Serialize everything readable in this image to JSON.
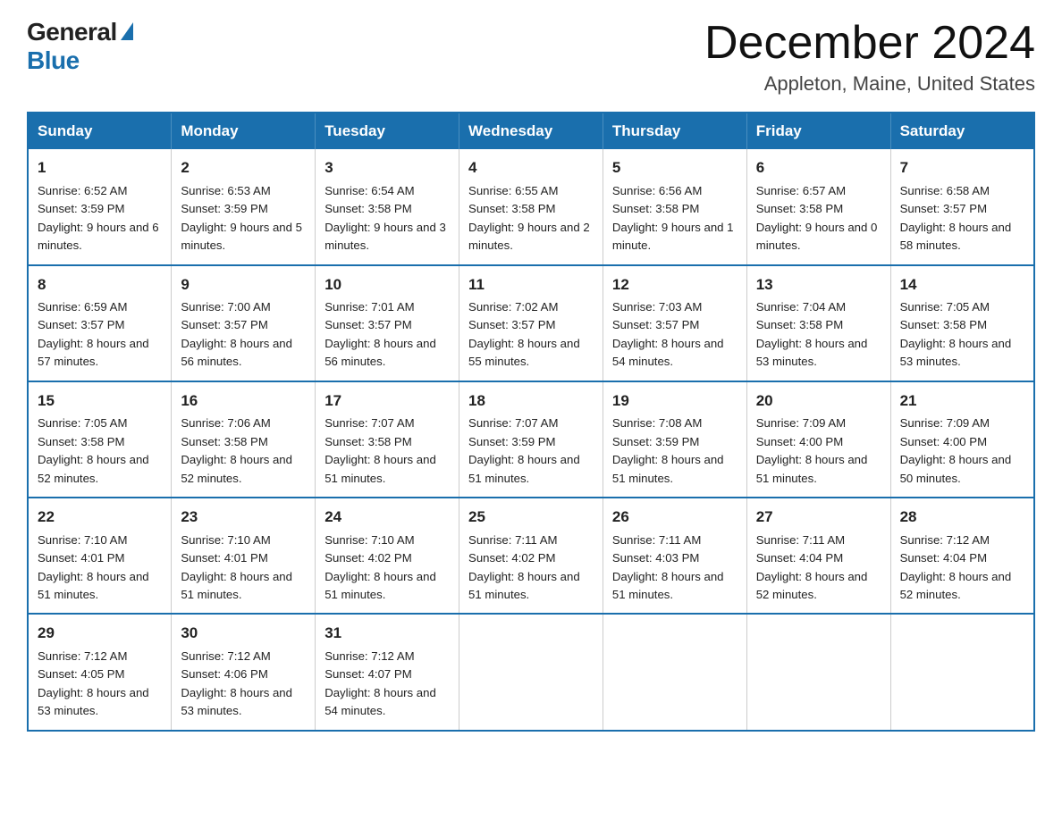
{
  "header": {
    "logo_general": "General",
    "logo_blue": "Blue",
    "month_title": "December 2024",
    "location": "Appleton, Maine, United States"
  },
  "days_of_week": [
    "Sunday",
    "Monday",
    "Tuesday",
    "Wednesday",
    "Thursday",
    "Friday",
    "Saturday"
  ],
  "weeks": [
    [
      {
        "day": "1",
        "sunrise": "6:52 AM",
        "sunset": "3:59 PM",
        "daylight": "9 hours and 6 minutes."
      },
      {
        "day": "2",
        "sunrise": "6:53 AM",
        "sunset": "3:59 PM",
        "daylight": "9 hours and 5 minutes."
      },
      {
        "day": "3",
        "sunrise": "6:54 AM",
        "sunset": "3:58 PM",
        "daylight": "9 hours and 3 minutes."
      },
      {
        "day": "4",
        "sunrise": "6:55 AM",
        "sunset": "3:58 PM",
        "daylight": "9 hours and 2 minutes."
      },
      {
        "day": "5",
        "sunrise": "6:56 AM",
        "sunset": "3:58 PM",
        "daylight": "9 hours and 1 minute."
      },
      {
        "day": "6",
        "sunrise": "6:57 AM",
        "sunset": "3:58 PM",
        "daylight": "9 hours and 0 minutes."
      },
      {
        "day": "7",
        "sunrise": "6:58 AM",
        "sunset": "3:57 PM",
        "daylight": "8 hours and 58 minutes."
      }
    ],
    [
      {
        "day": "8",
        "sunrise": "6:59 AM",
        "sunset": "3:57 PM",
        "daylight": "8 hours and 57 minutes."
      },
      {
        "day": "9",
        "sunrise": "7:00 AM",
        "sunset": "3:57 PM",
        "daylight": "8 hours and 56 minutes."
      },
      {
        "day": "10",
        "sunrise": "7:01 AM",
        "sunset": "3:57 PM",
        "daylight": "8 hours and 56 minutes."
      },
      {
        "day": "11",
        "sunrise": "7:02 AM",
        "sunset": "3:57 PM",
        "daylight": "8 hours and 55 minutes."
      },
      {
        "day": "12",
        "sunrise": "7:03 AM",
        "sunset": "3:57 PM",
        "daylight": "8 hours and 54 minutes."
      },
      {
        "day": "13",
        "sunrise": "7:04 AM",
        "sunset": "3:58 PM",
        "daylight": "8 hours and 53 minutes."
      },
      {
        "day": "14",
        "sunrise": "7:05 AM",
        "sunset": "3:58 PM",
        "daylight": "8 hours and 53 minutes."
      }
    ],
    [
      {
        "day": "15",
        "sunrise": "7:05 AM",
        "sunset": "3:58 PM",
        "daylight": "8 hours and 52 minutes."
      },
      {
        "day": "16",
        "sunrise": "7:06 AM",
        "sunset": "3:58 PM",
        "daylight": "8 hours and 52 minutes."
      },
      {
        "day": "17",
        "sunrise": "7:07 AM",
        "sunset": "3:58 PM",
        "daylight": "8 hours and 51 minutes."
      },
      {
        "day": "18",
        "sunrise": "7:07 AM",
        "sunset": "3:59 PM",
        "daylight": "8 hours and 51 minutes."
      },
      {
        "day": "19",
        "sunrise": "7:08 AM",
        "sunset": "3:59 PM",
        "daylight": "8 hours and 51 minutes."
      },
      {
        "day": "20",
        "sunrise": "7:09 AM",
        "sunset": "4:00 PM",
        "daylight": "8 hours and 51 minutes."
      },
      {
        "day": "21",
        "sunrise": "7:09 AM",
        "sunset": "4:00 PM",
        "daylight": "8 hours and 50 minutes."
      }
    ],
    [
      {
        "day": "22",
        "sunrise": "7:10 AM",
        "sunset": "4:01 PM",
        "daylight": "8 hours and 51 minutes."
      },
      {
        "day": "23",
        "sunrise": "7:10 AM",
        "sunset": "4:01 PM",
        "daylight": "8 hours and 51 minutes."
      },
      {
        "day": "24",
        "sunrise": "7:10 AM",
        "sunset": "4:02 PM",
        "daylight": "8 hours and 51 minutes."
      },
      {
        "day": "25",
        "sunrise": "7:11 AM",
        "sunset": "4:02 PM",
        "daylight": "8 hours and 51 minutes."
      },
      {
        "day": "26",
        "sunrise": "7:11 AM",
        "sunset": "4:03 PM",
        "daylight": "8 hours and 51 minutes."
      },
      {
        "day": "27",
        "sunrise": "7:11 AM",
        "sunset": "4:04 PM",
        "daylight": "8 hours and 52 minutes."
      },
      {
        "day": "28",
        "sunrise": "7:12 AM",
        "sunset": "4:04 PM",
        "daylight": "8 hours and 52 minutes."
      }
    ],
    [
      {
        "day": "29",
        "sunrise": "7:12 AM",
        "sunset": "4:05 PM",
        "daylight": "8 hours and 53 minutes."
      },
      {
        "day": "30",
        "sunrise": "7:12 AM",
        "sunset": "4:06 PM",
        "daylight": "8 hours and 53 minutes."
      },
      {
        "day": "31",
        "sunrise": "7:12 AM",
        "sunset": "4:07 PM",
        "daylight": "8 hours and 54 minutes."
      },
      null,
      null,
      null,
      null
    ]
  ]
}
